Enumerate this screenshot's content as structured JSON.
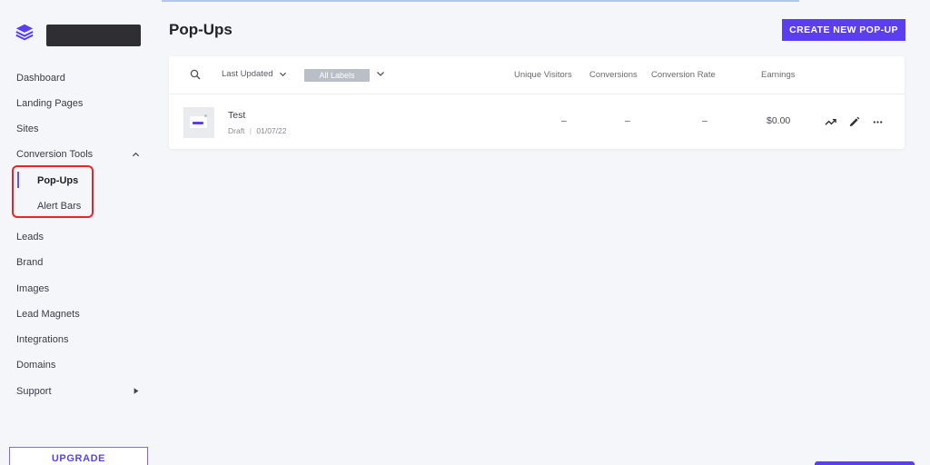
{
  "sidebar": {
    "items": [
      {
        "label": "Dashboard"
      },
      {
        "label": "Landing Pages"
      },
      {
        "label": "Sites"
      },
      {
        "label": "Conversion Tools"
      },
      {
        "label": "Leads"
      },
      {
        "label": "Brand"
      },
      {
        "label": "Images"
      },
      {
        "label": "Lead Magnets"
      },
      {
        "label": "Integrations"
      },
      {
        "label": "Domains"
      },
      {
        "label": "Support"
      }
    ],
    "sub_items": [
      {
        "label": "Pop-Ups",
        "active": true
      },
      {
        "label": "Alert Bars"
      }
    ],
    "upgrade_label": "UPGRADE"
  },
  "header": {
    "title": "Pop-Ups",
    "create_label": "CREATE NEW POP-UP"
  },
  "table": {
    "sort_label": "Last Updated",
    "labels_filter": "All Labels",
    "columns": [
      "Unique Visitors",
      "Conversions",
      "Conversion Rate",
      "Earnings"
    ],
    "rows": [
      {
        "name": "Test",
        "status": "Draft",
        "date": "01/07/22",
        "unique_visitors": "–",
        "conversions": "–",
        "conversion_rate": "–",
        "earnings": "$0.00"
      }
    ]
  },
  "colors": {
    "accent": "#5b3ef0",
    "highlight": "#e8262a"
  }
}
